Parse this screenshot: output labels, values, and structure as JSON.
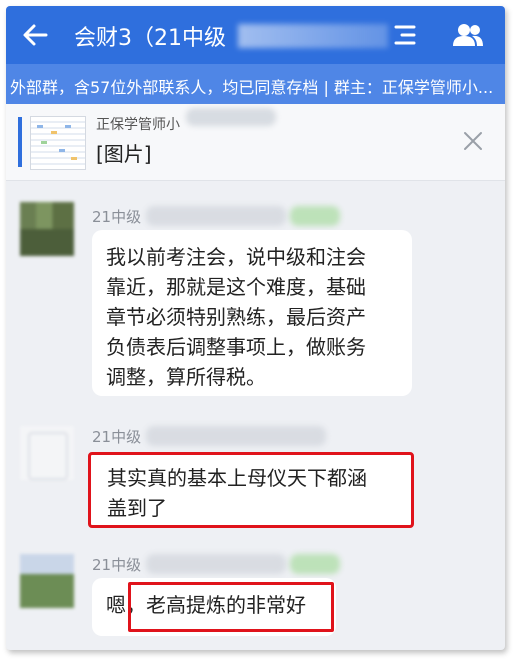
{
  "header": {
    "title": "会财3（21中级",
    "back_icon": "back-arrow-icon",
    "menu_icon": "menu-icon",
    "members_icon": "group-members-icon",
    "bar_color": "#2f6fdd"
  },
  "subheader": {
    "text": "外部群，含57位外部联系人，均已同意存档 | 群主：正保学管师小..."
  },
  "pinned": {
    "sender": "正保学管师小",
    "content": "[图片]",
    "close_icon": "close-icon"
  },
  "messages": [
    {
      "sender": "21中级",
      "lines": [
        "我以前考注会，说中级和注会",
        "靠近，那就是这个难度，基础",
        "章节必须特别熟练，最后资产",
        "负债表后调整事项上，做账务",
        "调整，算所得税。"
      ]
    },
    {
      "sender": "21中级",
      "lines": [
        "其实真的基本上母仪天下都涵",
        "盖到了"
      ],
      "highlighted": true
    },
    {
      "sender": "21中级",
      "lines": [
        "嗯，老高提炼的非常好"
      ],
      "highlighted_part": "老高提炼的非常好"
    }
  ],
  "colors": {
    "highlight_border": "#e0131b",
    "chat_background": "#eef0f4"
  }
}
